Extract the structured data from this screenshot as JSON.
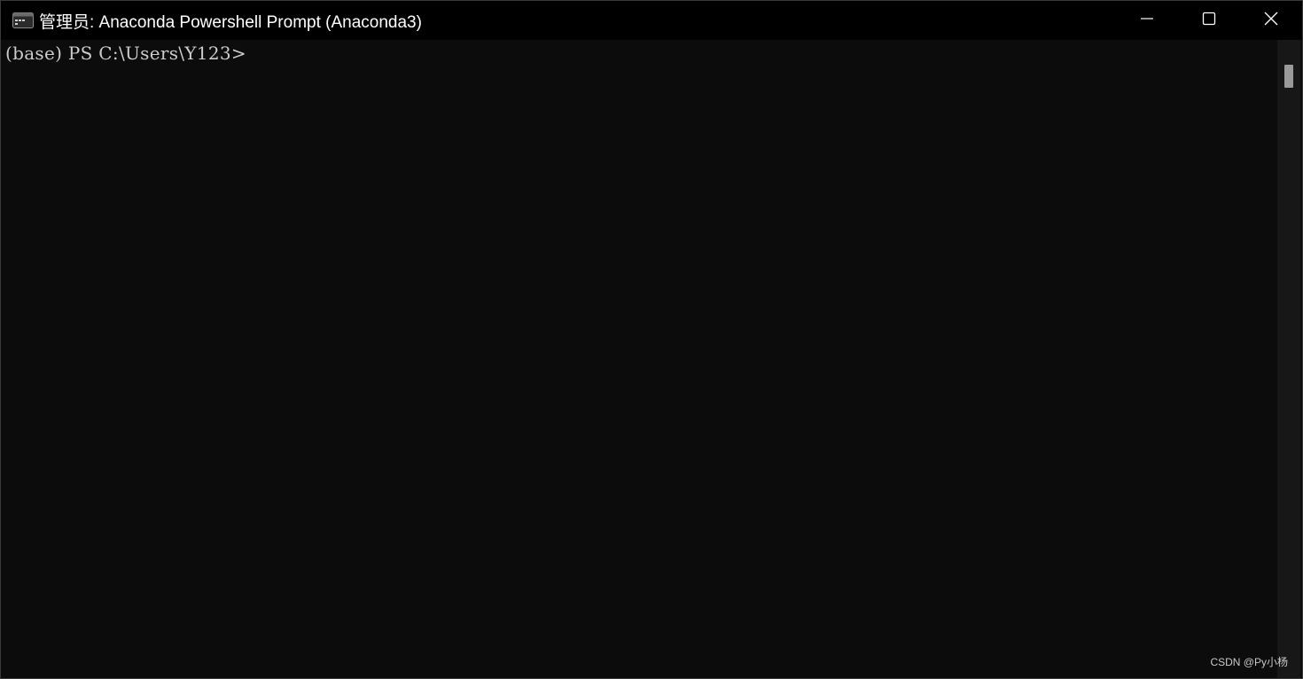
{
  "window": {
    "title": "管理员: Anaconda Powershell Prompt (Anaconda3)",
    "controls": {
      "minimize_icon": "minimize-icon",
      "maximize_icon": "maximize-icon",
      "close_icon": "close-icon"
    }
  },
  "console": {
    "prompt": "(base) PS C:\\Users\\Y123>",
    "background_color": "#0c0c0c",
    "text_color": "#cccccc"
  },
  "watermark": {
    "text": "CSDN @Py小杨"
  }
}
